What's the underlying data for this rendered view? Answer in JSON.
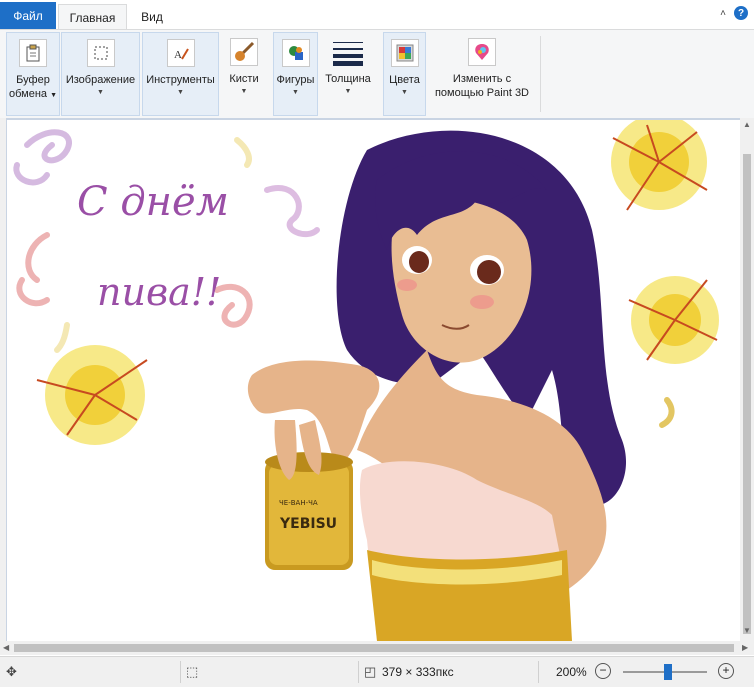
{
  "tabs": {
    "file": "Файл",
    "home": "Главная",
    "view": "Вид"
  },
  "window": {
    "collapse_icon": "chevron-up-icon",
    "help_label": "?"
  },
  "ribbon": {
    "clipboard": {
      "label1": "Буфер",
      "label2": "обмена"
    },
    "image": {
      "label": "Изображение"
    },
    "tools": {
      "label": "Инструменты"
    },
    "brushes": {
      "label": "Кисти"
    },
    "shapes": {
      "label": "Фигуры"
    },
    "size": {
      "label": "Толщина"
    },
    "colors": {
      "label": "Цвета"
    },
    "paint3d": {
      "label1": "Изменить с",
      "label2": "помощью Paint 3D"
    }
  },
  "canvas": {
    "text_line1": "С днём",
    "text_line2": "пива!!",
    "can_text1": "YEBISU",
    "can_text2": "ЧЕ-ВАН-ЧА"
  },
  "statusbar": {
    "dimensions": "379 × 333пкс",
    "zoom": "200%",
    "zoom_level_fraction": 0.55
  },
  "colors": {
    "accent": "#1e6fc7",
    "hair": "#3a1f6e",
    "skin": "#e6b48a",
    "beer": "#d9a625"
  }
}
